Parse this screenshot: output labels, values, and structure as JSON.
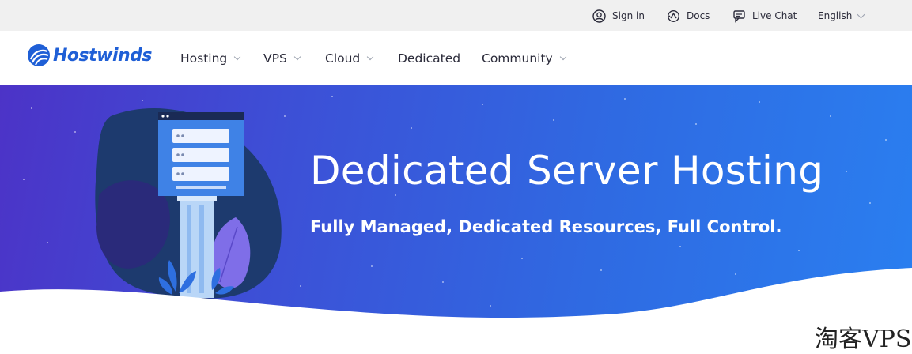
{
  "topbar": {
    "sign_in": "Sign in",
    "docs": "Docs",
    "live_chat": "Live Chat",
    "language": "English"
  },
  "nav": {
    "logo": "Hostwinds",
    "items": [
      {
        "label": "Hosting",
        "has_dropdown": true
      },
      {
        "label": "VPS",
        "has_dropdown": true
      },
      {
        "label": "Cloud",
        "has_dropdown": true
      },
      {
        "label": "Dedicated",
        "has_dropdown": false
      },
      {
        "label": "Community",
        "has_dropdown": true
      }
    ]
  },
  "hero": {
    "title": "Dedicated Server Hosting",
    "subtitle": "Fully Managed, Dedicated Resources, Full Control."
  },
  "watermark": "淘客VPS",
  "colors": {
    "brand": "#1f5fd6",
    "hero_start": "#4c33c7",
    "hero_end": "#2a7ff0",
    "topbar_bg": "#f0f0f0"
  },
  "icons": [
    "user-icon",
    "docs-icon",
    "chat-icon",
    "chevron-down-icon",
    "server-illustration",
    "logo-icon"
  ]
}
